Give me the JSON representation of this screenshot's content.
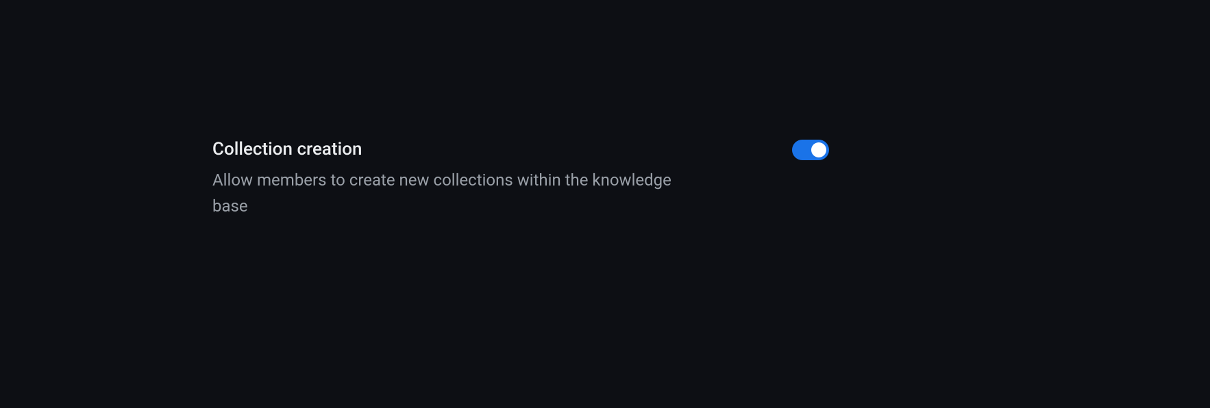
{
  "setting": {
    "title": "Collection creation",
    "description": "Allow members to create new collections within the knowledge base",
    "enabled": true
  }
}
